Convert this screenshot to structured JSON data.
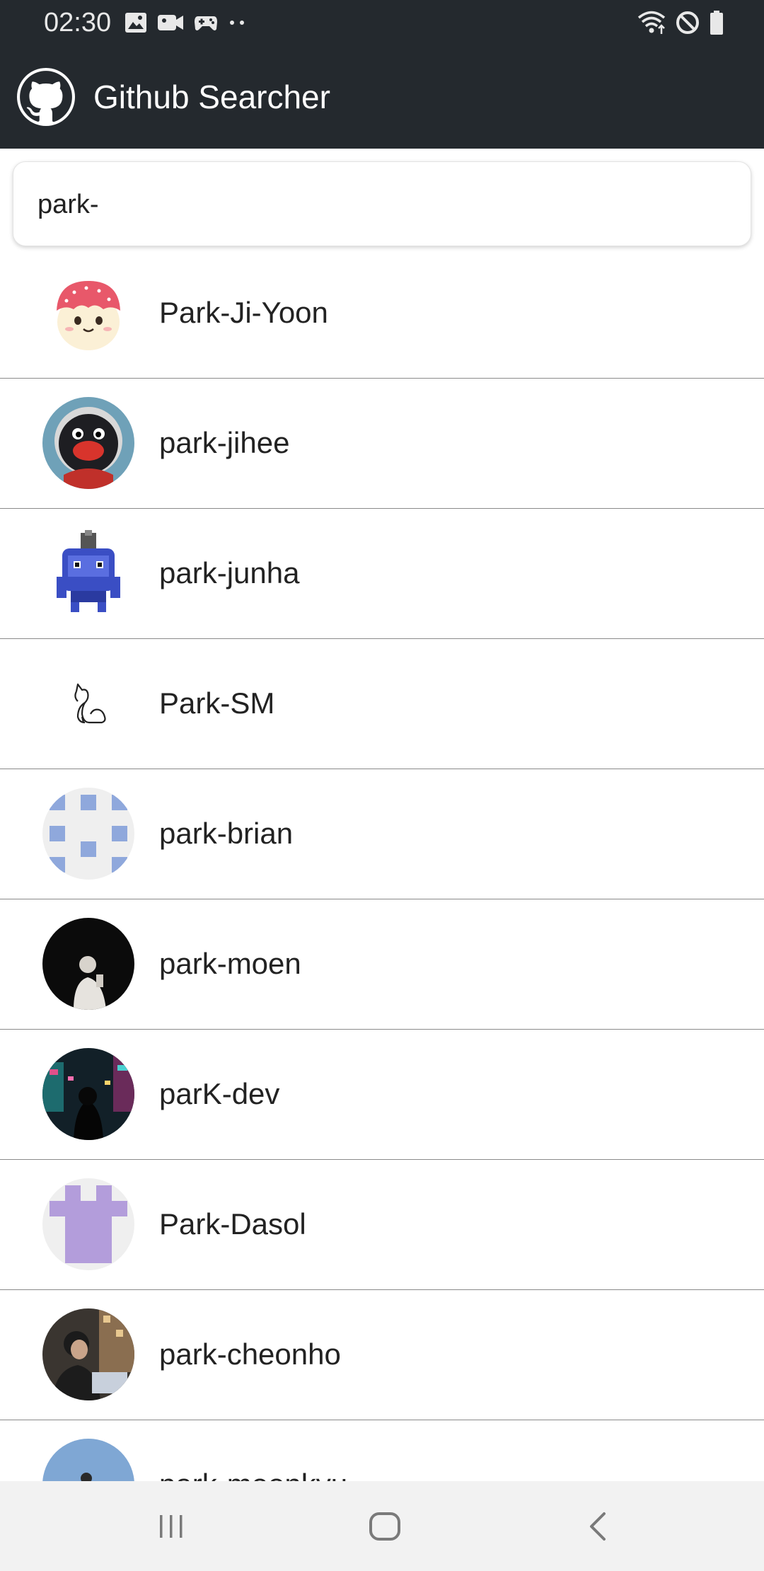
{
  "status_bar": {
    "time": "02:30",
    "left_icons": [
      "image-icon",
      "video-camera-icon",
      "gamepad-icon",
      "more-dots-icon"
    ],
    "right_icons": [
      "wifi-icon",
      "do-not-disturb-icon",
      "battery-icon"
    ]
  },
  "app_bar": {
    "title": "Github Searcher",
    "logo_icon": "github-logo-icon",
    "background": "#24292e"
  },
  "search": {
    "value": "park-"
  },
  "users": [
    {
      "login": "Park-Ji-Yoon",
      "avatar": "cartoon-face-avatar"
    },
    {
      "login": "park-jihee",
      "avatar": "penguin-avatar"
    },
    {
      "login": "park-junha",
      "avatar": "pixel-creature-avatar"
    },
    {
      "login": "Park-SM",
      "avatar": "cat-outline-avatar"
    },
    {
      "login": "park-brian",
      "avatar": "identicon-blue-avatar"
    },
    {
      "login": "park-moen",
      "avatar": "photo-person-dark-avatar"
    },
    {
      "login": "parK-dev",
      "avatar": "photo-neon-street-avatar"
    },
    {
      "login": "Park-Dasol",
      "avatar": "identicon-purple-avatar"
    },
    {
      "login": "park-cheonho",
      "avatar": "photo-person-laptop-avatar"
    },
    {
      "login": "park-moonkyu",
      "avatar": "photo-sky-avatar"
    }
  ],
  "nav_bar": {
    "buttons": [
      "recent-apps-icon",
      "home-icon",
      "back-icon"
    ]
  }
}
